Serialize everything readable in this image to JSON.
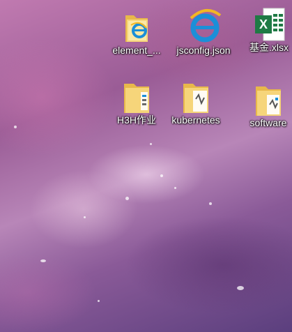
{
  "desktop": {
    "icons": [
      {
        "label": "element_...",
        "icon": "ie-folder-icon"
      },
      {
        "label": "jsconfig.json",
        "icon": "ie-file-icon"
      },
      {
        "label": "基金.xlsx",
        "icon": "excel-icon"
      },
      {
        "label": "H3H作业",
        "icon": "folder-icon"
      },
      {
        "label": "kubernetes",
        "icon": "folder-icon"
      },
      {
        "label": "software",
        "icon": "folder-icon"
      }
    ]
  },
  "colors": {
    "folder": "#f6d57a",
    "ie_blue": "#1b8fd8",
    "excel_green": "#1f7a45"
  }
}
